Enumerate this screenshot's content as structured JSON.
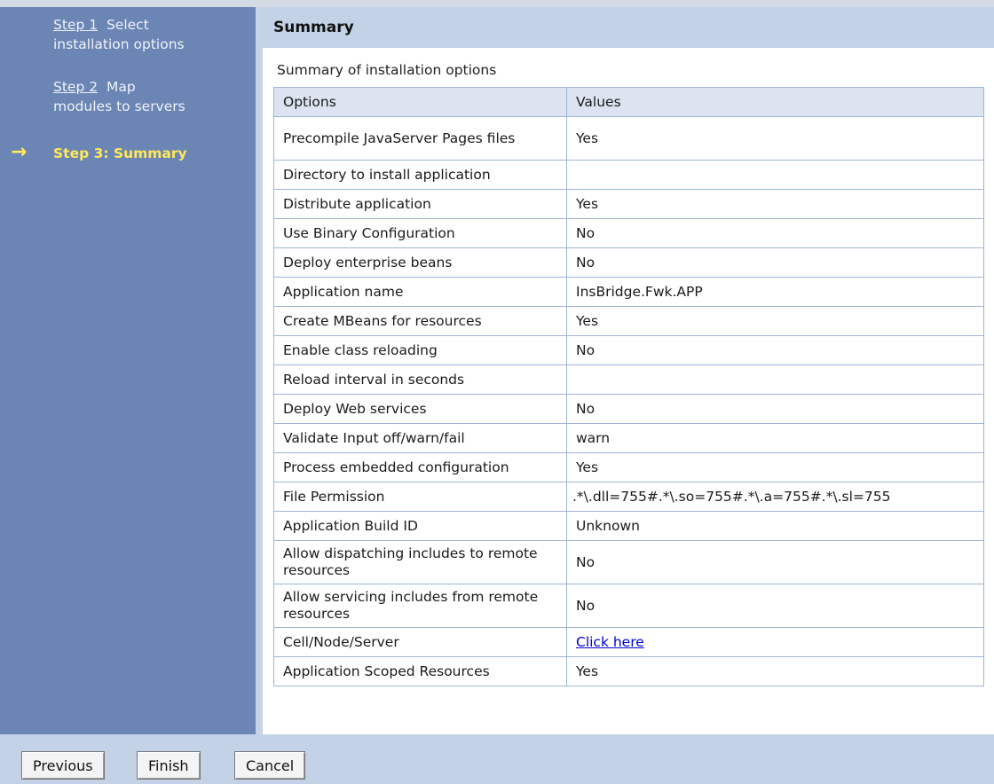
{
  "sidebar": {
    "step1": {
      "link": "Step 1",
      "label1": "Select",
      "label2": "installation options"
    },
    "step2": {
      "link": "Step 2",
      "label1": "Map",
      "label2": "modules to servers"
    },
    "step3": {
      "label": "Step 3: Summary"
    }
  },
  "panel": {
    "title": "Summary",
    "caption": "Summary of installation options"
  },
  "table": {
    "headers": {
      "options": "Options",
      "values": "Values"
    },
    "rows": [
      {
        "option": "Precompile JavaServer Pages files",
        "value": "Yes"
      },
      {
        "option": "Directory to install application",
        "value": ""
      },
      {
        "option": "Distribute application",
        "value": "Yes"
      },
      {
        "option": "Use Binary Configuration",
        "value": "No"
      },
      {
        "option": "Deploy enterprise beans",
        "value": "No"
      },
      {
        "option": "Application name",
        "value": "InsBridge.Fwk.APP"
      },
      {
        "option": "Create MBeans for resources",
        "value": "Yes"
      },
      {
        "option": "Enable class reloading",
        "value": "No"
      },
      {
        "option": "Reload interval in seconds",
        "value": ""
      },
      {
        "option": "Deploy Web services",
        "value": "No"
      },
      {
        "option": "Validate Input off/warn/fail",
        "value": "warn"
      },
      {
        "option": "Process embedded configuration",
        "value": "Yes"
      },
      {
        "option": "File Permission",
        "value": ".*\\.dll=755#.*\\.so=755#.*\\.a=755#.*\\.sl=755"
      },
      {
        "option": "Application Build ID",
        "value": "Unknown"
      },
      {
        "option": "Allow dispatching includes to remote resources",
        "value": "No"
      },
      {
        "option": "Allow servicing includes from remote resources",
        "value": "No"
      },
      {
        "option": "Cell/Node/Server",
        "value": "Click here"
      },
      {
        "option": "Application Scoped Resources",
        "value": "Yes"
      }
    ]
  },
  "buttons": {
    "previous": "Previous",
    "finish": "Finish",
    "cancel": "Cancel"
  }
}
